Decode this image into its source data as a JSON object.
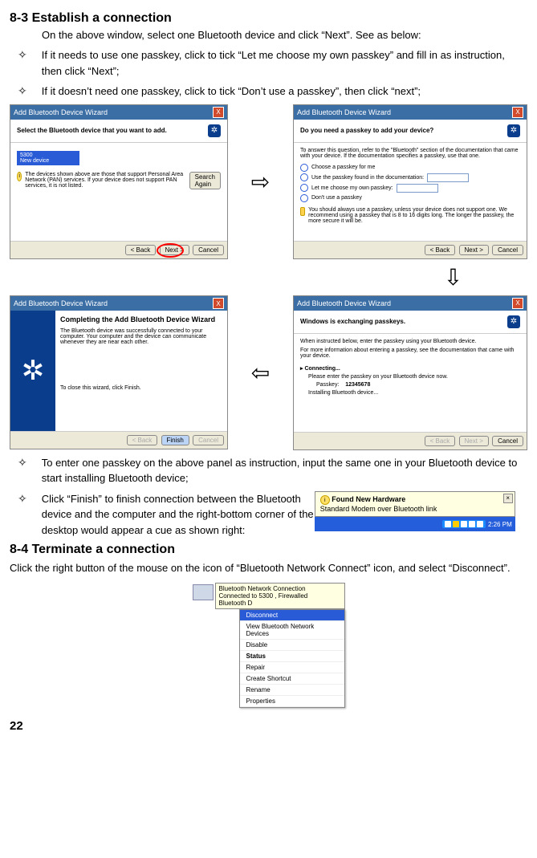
{
  "section83": {
    "heading": "8-3 Establish a connection",
    "intro": "On the above window, select one Bluetooth device and click “Next”. See as below:",
    "b1": "If it needs to use one passkey, click to tick “Let me choose my own passkey” and fill in as instruction, then click “Next”;",
    "b2": "If it doesn’t need one passkey, click to tick “Don’t use a passkey”, then click “next”;",
    "b3": "To enter one passkey on the above panel as instruction, input the same one in your Bluetooth device to start installing Bluetooth device;",
    "b4": "Click “Finish” to finish connection between the Bluetooth device and the computer and the right-bottom corner of the desktop would appear a cue as shown right:"
  },
  "wiz": {
    "title": "Add Bluetooth Device Wizard",
    "close": "X",
    "sel_hdr": "Select the Bluetooth device that you want to add.",
    "dev1": "5300",
    "dev2": "New device",
    "sel_note": "The devices shown above are those that support Personal Area Network (PAN) services. If your device does not support PAN services, it is not listed.",
    "search": "Search Again",
    "back": "< Back",
    "next": "Next >",
    "cancel": "Cancel",
    "pk_hdr": "Do you need a passkey to add your device?",
    "pk_intro": "To answer this question, refer to the \"Bluetooth\" section of the documentation that came with your device. If the documentation specifies a passkey, use that one.",
    "pk_r1": "Choose a passkey for me",
    "pk_r2": "Use the passkey found in the documentation:",
    "pk_r3": "Let me choose my own passkey:",
    "pk_r4": "Don't use a passkey",
    "pk_warn": "You should always use a passkey, unless your device does not support one. We recommend using a passkey that is 8 to 16 digits long. The longer the passkey, the more secure it will be.",
    "ex_hdr": "Windows is exchanging passkeys.",
    "ex_l1": "When instructed below, enter the passkey using your Bluetooth device.",
    "ex_l2": "For more information about entering a passkey, see the documentation that came with your device.",
    "ex_conn": "Connecting...",
    "ex_pk_lbl": "Please enter the passkey on your Bluetooth device now.",
    "ex_pk_k": "Passkey:",
    "ex_pk_v": "12345678",
    "ex_inst": "Installing Bluetooth device...",
    "fin_hdr": "Completing the Add Bluetooth Device Wizard",
    "fin_l1": "The Bluetooth device was successfully connected to your computer. Your computer and the device can communicate whenever they are near each other.",
    "fin_l2": "To close this wizard, click Finish.",
    "finish": "Finish"
  },
  "balloon": {
    "title": "Found New Hardware",
    "body": "Standard Modem over Bluetooth link",
    "time": "2:26 PM"
  },
  "section84": {
    "heading": "8-4 Terminate a connection",
    "text": "Click the right button of the mouse on the icon of “Bluetooth Network Connect” icon, and select “Disconnect”."
  },
  "nettip": {
    "l1": "Bluetooth Network Connection",
    "l2": "Connected to 5300 , Firewalled",
    "l3": "Bluetooth D"
  },
  "menu": {
    "m1": "Disconnect",
    "m2": "View Bluetooth Network Devices",
    "m3": "Disable",
    "m4": "Status",
    "m5": "Repair",
    "m6": "Create Shortcut",
    "m7": "Rename",
    "m8": "Properties"
  },
  "page": "22"
}
